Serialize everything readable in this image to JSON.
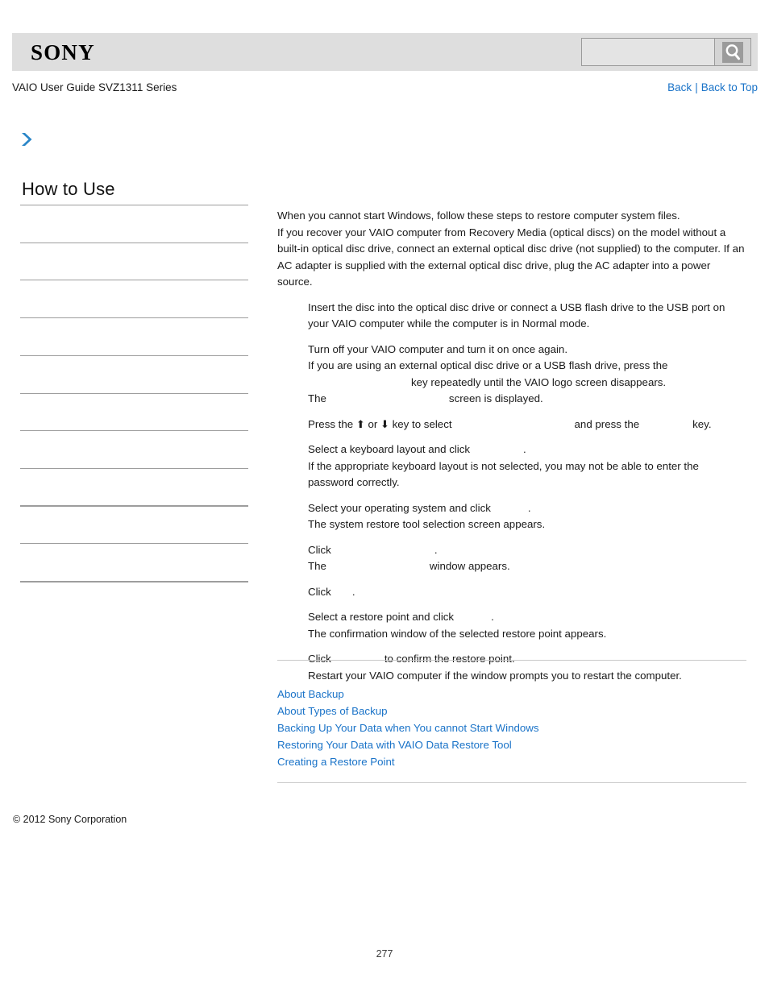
{
  "header": {
    "logo_text": "SONY",
    "search": {
      "value": "",
      "placeholder": "",
      "button_icon": "search-icon"
    }
  },
  "subheader": {
    "guide_title": "VAIO User Guide SVZ1311 Series",
    "back_label": "Back",
    "separator": "|",
    "back_to_top_label": "Back to Top"
  },
  "breadcrumb": {
    "arrow_icon": "chevron-right-icon"
  },
  "sidebar": {
    "title": "How to Use",
    "items": [
      {
        "label": ""
      },
      {
        "label": ""
      },
      {
        "label": ""
      },
      {
        "label": ""
      },
      {
        "label": ""
      },
      {
        "label": ""
      },
      {
        "label": ""
      },
      {
        "label": ""
      },
      {
        "label": ""
      },
      {
        "label": ""
      }
    ]
  },
  "content": {
    "intro": [
      "When you cannot start Windows, follow these steps to restore computer system files.",
      "If you recover your VAIO computer from Recovery Media (optical discs) on the model without a built-in optical disc drive, connect an external optical disc drive (not supplied) to the computer. If an AC adapter is supplied with the external optical disc drive, plug the AC adapter into a power source."
    ],
    "steps": [
      {
        "lines": [
          "Insert the disc into the optical disc drive or connect a USB flash drive to the USB port on your VAIO computer while the computer is in Normal mode."
        ]
      },
      {
        "lines": [
          "Turn off your VAIO computer and turn it on once again.",
          "If you are using an external optical disc drive or a USB flash drive, press the",
          "key repeatedly until the VAIO logo screen disappears.",
          "The",
          "screen is displayed."
        ]
      },
      {
        "lines": [
          "Press the",
          "or",
          "key to select",
          "and press the",
          "key."
        ],
        "up_arrow": "⬆",
        "down_arrow": "⬇"
      },
      {
        "lines": [
          "Select a keyboard layout and click",
          ".",
          "If the appropriate keyboard layout is not selected, you may not be able to enter the password correctly."
        ]
      },
      {
        "lines": [
          "Select your operating system and click",
          ".",
          "The system restore tool selection screen appears."
        ]
      },
      {
        "lines": [
          "Click",
          ".",
          "The",
          "window appears."
        ]
      },
      {
        "lines": [
          "Click",
          "."
        ]
      },
      {
        "lines": [
          "Select a restore point and click",
          ".",
          "The confirmation window of the selected restore point appears."
        ]
      },
      {
        "lines": [
          "Click",
          "to confirm the restore point.",
          "Restart your VAIO computer if the window prompts you to restart the computer."
        ]
      }
    ]
  },
  "related_topics": [
    "About Backup",
    "About Types of Backup",
    "Backing Up Your Data when You cannot Start Windows",
    "Restoring Your Data with VAIO Data Restore Tool",
    "Creating a Restore Point"
  ],
  "footer": {
    "copyright": "© 2012 Sony Corporation",
    "page_number": "277"
  },
  "colors": {
    "link": "#1a73c8",
    "header_bar": "#dedede",
    "rule": "#9d9d9d"
  }
}
